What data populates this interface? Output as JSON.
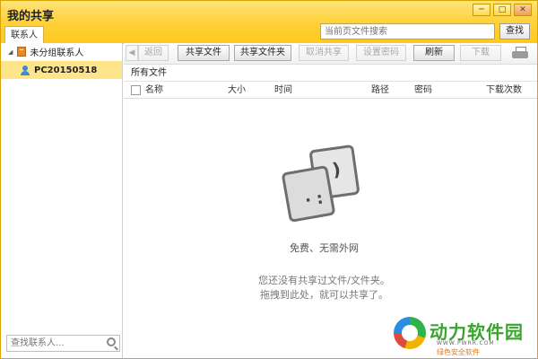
{
  "window": {
    "title": "我的共享",
    "controls": [
      "minimize",
      "maximize",
      "close"
    ]
  },
  "search": {
    "placeholder": "当前页文件搜索",
    "button_label": "查找"
  },
  "left_tab": {
    "label": "联系人"
  },
  "contacts": {
    "group_label": "未分组联系人",
    "items": [
      {
        "label": "PC20150518"
      }
    ],
    "search_placeholder": "查找联系人..."
  },
  "toolbar": {
    "back_label": "返回",
    "share_file_label": "共享文件",
    "share_folder_label": "共享文件夹",
    "cancel_share_label": "取消共享",
    "set_password_label": "设置密码",
    "refresh_label": "刷新",
    "download_label": "下载"
  },
  "breadcrumb": {
    "label": "所有文件"
  },
  "table": {
    "columns": [
      "名称",
      "大小",
      "时间",
      "路径",
      "密码",
      "下载次数"
    ]
  },
  "empty_state": {
    "title": "免费、无需外网",
    "line1": "您还没有共享过文件/文件夹。",
    "line2": "拖拽到此处，就可以共享了。"
  },
  "watermark": {
    "brand": "动力软件园",
    "url": "WWW.PWRR.COM",
    "tagline": "绿色安全软件"
  },
  "colors": {
    "titlebar": "#ffd23f",
    "selected_row": "#ffe58a",
    "brand_green": "#3aa42f"
  }
}
